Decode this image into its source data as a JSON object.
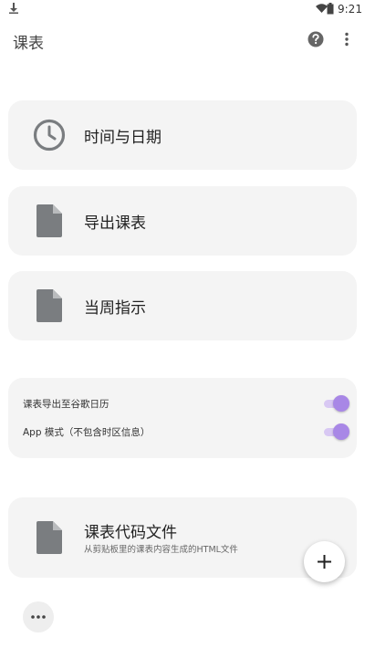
{
  "status_bar": {
    "time": "9:21"
  },
  "app_bar": {
    "title": "课表"
  },
  "cards": {
    "time_date": {
      "label": "时间与日期"
    },
    "export": {
      "label": "导出课表"
    },
    "week": {
      "label": "当周指示"
    }
  },
  "settings": {
    "google_calendar": {
      "label": "课表导出至谷歌日历",
      "enabled": true
    },
    "app_mode": {
      "label": "App 模式（不包含时区信息）",
      "enabled": true
    }
  },
  "code_file": {
    "title": "课表代码文件",
    "subtitle": "从剪贴板里的课表内容生成的HTML文件"
  },
  "colors": {
    "accent": "#a887e6",
    "card_bg": "#f4f4f4"
  },
  "icons": {
    "download": "download-icon",
    "wifi": "wifi-icon",
    "battery": "battery-icon",
    "help": "help-icon",
    "menu": "more-vert-icon",
    "clock": "clock-icon",
    "file": "file-icon",
    "add": "add-icon",
    "more": "more-horiz-icon"
  }
}
